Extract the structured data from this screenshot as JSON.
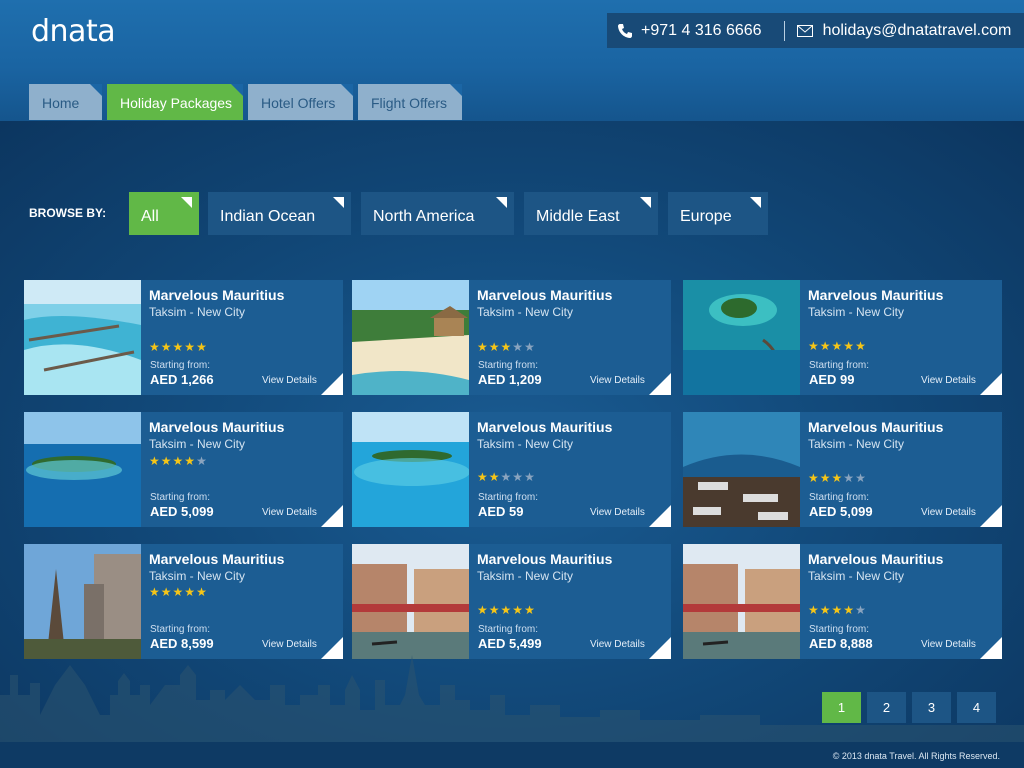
{
  "brand": {
    "logo_text": "dnata"
  },
  "contact": {
    "phone": "+971 4 316 6666",
    "email": "holidays@dnatatravel.com",
    "phone_icon": "phone-icon",
    "email_icon": "envelope-icon"
  },
  "tabs": [
    {
      "label": "Home",
      "active": false
    },
    {
      "label": "Holiday Packages",
      "active": true
    },
    {
      "label": "Hotel Offers",
      "active": false
    },
    {
      "label": "Flight Offers",
      "active": false
    }
  ],
  "browse": {
    "label": "BROWSE BY:",
    "filters": [
      {
        "label": "All",
        "active": true
      },
      {
        "label": "Indian Ocean",
        "active": false
      },
      {
        "label": "North America",
        "active": false
      },
      {
        "label": "Middle East",
        "active": false
      },
      {
        "label": "Europe",
        "active": false
      }
    ]
  },
  "cards": [
    {
      "title": "Marvelous Mauritius",
      "subtitle": "Taksim - New City",
      "rating": 5,
      "starting_label": "Starting from:",
      "price": "AED 1,266",
      "details_label": "View Details",
      "image": "maldives-water-villas"
    },
    {
      "title": "Marvelous Mauritius",
      "subtitle": "Taksim - New City",
      "rating": 3,
      "starting_label": "Starting from:",
      "price": "AED  1,209",
      "details_label": "View Details",
      "image": "beach-hut"
    },
    {
      "title": "Marvelous Mauritius",
      "subtitle": "Taksim - New City",
      "rating": 5,
      "starting_label": "Starting from:",
      "price": "AED 99",
      "details_label": "View Details",
      "image": "atoll-resort"
    },
    {
      "title": "Marvelous Mauritius",
      "subtitle": "Taksim - New City",
      "rating": 4,
      "starting_label": "Starting from:",
      "price": "AED 5,099",
      "details_label": "View Details",
      "image": "island-aerial"
    },
    {
      "title": "Marvelous Mauritius",
      "subtitle": "Taksim - New City",
      "rating": 2,
      "starting_label": "Starting from:",
      "price": "AED 59",
      "details_label": "View Details",
      "image": "lagoon-island"
    },
    {
      "title": "Marvelous Mauritius",
      "subtitle": "Taksim - New City",
      "rating": 3,
      "starting_label": "Starting from:",
      "price": "AED 5,099",
      "details_label": "View Details",
      "image": "underwater-restaurant"
    },
    {
      "title": "Marvelous Mauritius",
      "subtitle": "Taksim - New City",
      "rating": 5,
      "starting_label": "Starting from:",
      "price": "AED 8,599",
      "details_label": "View Details",
      "image": "paris-eiffel"
    },
    {
      "title": "Marvelous Mauritius",
      "subtitle": "Taksim - New City",
      "rating": 5,
      "starting_label": "Starting from:",
      "price": "AED 5,499",
      "details_label": "View Details",
      "image": "venice-canal"
    },
    {
      "title": "Marvelous Mauritius",
      "subtitle": "Taksim - New City",
      "rating": 4,
      "starting_label": "Starting from:",
      "price": "AED 8,888",
      "details_label": "View Details",
      "image": "venice-canal"
    }
  ],
  "pagination": {
    "pages": [
      "1",
      "2",
      "3",
      "4"
    ],
    "current": "1"
  },
  "footer": {
    "copyright": "© 2013 dnata Travel. All Rights Reserved."
  },
  "colors": {
    "accent_green": "#61b847",
    "card_blue": "#1c5d93",
    "star_gold": "#f5c518"
  }
}
